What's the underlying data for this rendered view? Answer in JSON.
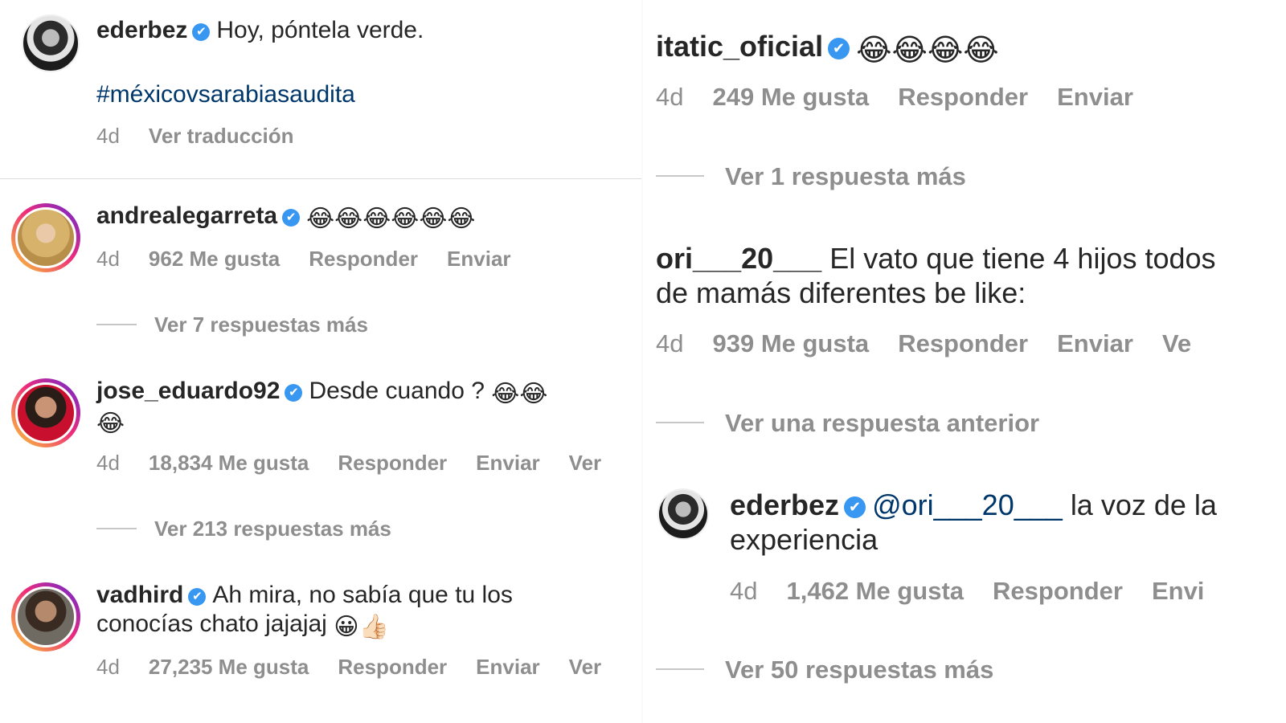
{
  "left": {
    "post": {
      "username": "ederbez",
      "caption": "Hoy, póntela verde.",
      "hashtag": "#méxicovsarabiasaudita",
      "time": "4d",
      "translate": "Ver traducción"
    },
    "comments": [
      {
        "username": "andrealegarreta",
        "text": "",
        "emoji": "😂😂😂😂😂😂",
        "time": "4d",
        "likes": "962 Me gusta",
        "reply": "Responder",
        "send": "Enviar",
        "more_replies": "Ver 7 respuestas más"
      },
      {
        "username": "jose_eduardo92",
        "text": "Desde cuando ?",
        "emoji": "😂😂",
        "emoji2": "😂",
        "time": "4d",
        "likes": "18,834 Me gusta",
        "reply": "Responder",
        "send": "Enviar",
        "cut": "Ver",
        "more_replies": "Ver 213 respuestas más"
      },
      {
        "username": "vadhird",
        "text": "Ah mira, no sabía que tu los",
        "text2": "conocías chato jajajaj",
        "emoji": "😀👍🏻",
        "time": "4d",
        "likes": "27,235 Me gusta",
        "reply": "Responder",
        "send": "Enviar",
        "cut": "Ver"
      }
    ]
  },
  "right": {
    "comments": [
      {
        "username": "itatic_oficial",
        "emoji": "😂😂😂😂",
        "time": "4d",
        "likes": "249 Me gusta",
        "reply": "Responder",
        "send": "Enviar",
        "more_replies": "Ver 1 respuesta más"
      },
      {
        "username": "ori___20___",
        "text": "El vato que tiene 4 hijos todos",
        "text2": "de mamás diferentes be like:",
        "time": "4d",
        "likes": "939 Me gusta",
        "reply": "Responder",
        "send": "Enviar",
        "cut": "Ve",
        "previous_reply": "Ver una respuesta anterior"
      },
      {
        "username": "ederbez",
        "mention": "@ori___20___",
        "text": "la voz de la",
        "text2": "experiencia",
        "time": "4d",
        "likes": "1,462 Me gusta",
        "reply": "Responder",
        "send": "Envi",
        "more_replies": "Ver 50 respuestas más"
      }
    ]
  },
  "icons": {
    "verified": "✔"
  },
  "colors": {
    "verified": "#3897f0",
    "link": "#00376b",
    "meta": "#8e8e8e"
  }
}
